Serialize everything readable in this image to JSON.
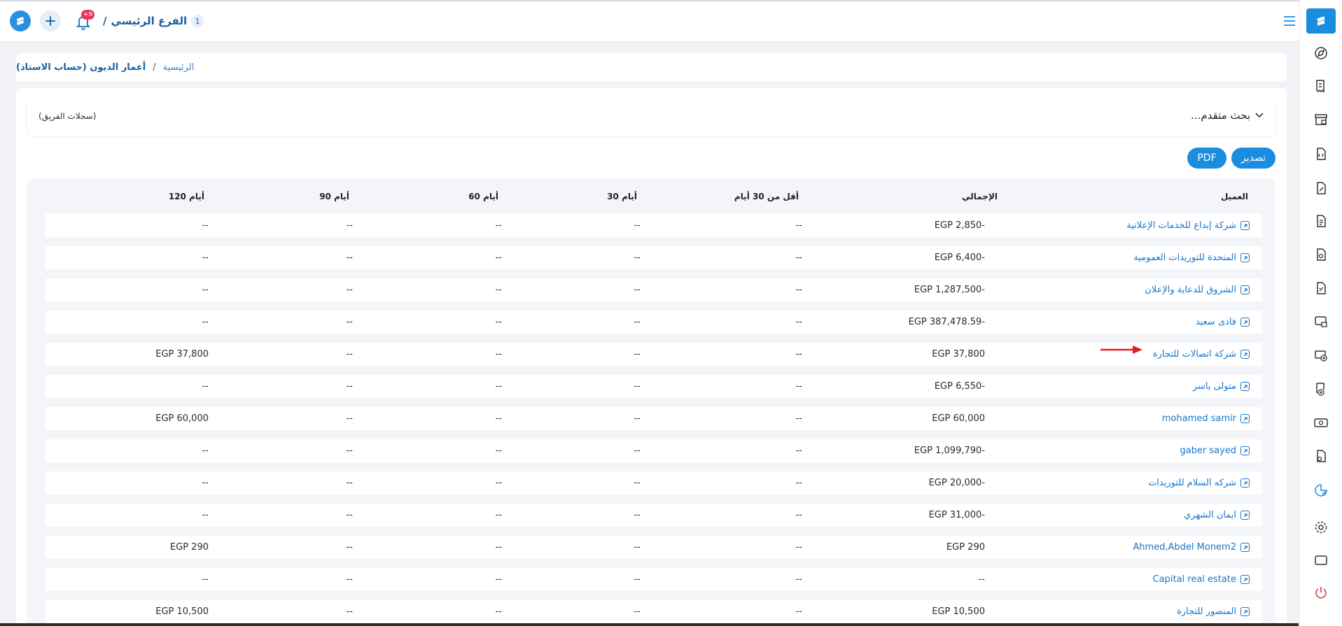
{
  "topbar": {
    "branch_count": "1",
    "branch_name": "الفرع الرئيسي",
    "branch_sep": "/",
    "notification_count": "+9"
  },
  "breadcrumb": {
    "home": "الرئيسية",
    "separator": "/",
    "current": "أعمار الديون (حساب الاستاذ)"
  },
  "search": {
    "label": "بحث متقدم...",
    "team_records": "(سجلات الفريق)"
  },
  "actions": {
    "export": "تصدير",
    "pdf": "PDF"
  },
  "table": {
    "headers": {
      "customer": "العميل",
      "total": "الإجمالي",
      "lt30": "أقل من 30 أيام",
      "d30": "30 أيام",
      "d60": "60 أيام",
      "d90": "90 أيام",
      "d120": "120 أيام"
    },
    "rows": [
      {
        "customer": "شركة إبداع للخدمات الإعلانية",
        "total": "EGP 2,850-",
        "lt30": "--",
        "d30": "--",
        "d60": "--",
        "d90": "--",
        "d120": "--"
      },
      {
        "customer": "المتحدة للتوريدات العمومية",
        "total": "EGP 6,400-",
        "lt30": "--",
        "d30": "--",
        "d60": "--",
        "d90": "--",
        "d120": "--"
      },
      {
        "customer": "الشروق للدعاية والإعلان",
        "total": "EGP 1,287,500-",
        "lt30": "--",
        "d30": "--",
        "d60": "--",
        "d90": "--",
        "d120": "--"
      },
      {
        "customer": "فادى سعيد",
        "total": "EGP 387,478.59-",
        "lt30": "--",
        "d30": "--",
        "d60": "--",
        "d90": "--",
        "d120": "--"
      },
      {
        "customer": "شركة اتصالات للتجارة",
        "total": "EGP 37,800",
        "lt30": "--",
        "d30": "--",
        "d60": "--",
        "d90": "--",
        "d120": "EGP 37,800"
      },
      {
        "customer": "متولى ياسر",
        "total": "EGP 6,550-",
        "lt30": "--",
        "d30": "--",
        "d60": "--",
        "d90": "--",
        "d120": "--"
      },
      {
        "customer": "mohamed samir",
        "total": "EGP 60,000",
        "lt30": "--",
        "d30": "--",
        "d60": "--",
        "d90": "--",
        "d120": "EGP 60,000"
      },
      {
        "customer": "gaber sayed",
        "total": "EGP 1,099,790-",
        "lt30": "--",
        "d30": "--",
        "d60": "--",
        "d90": "--",
        "d120": "--"
      },
      {
        "customer": "شركه السلام للتوريدات",
        "total": "EGP 20,000-",
        "lt30": "--",
        "d30": "--",
        "d60": "--",
        "d90": "--",
        "d120": "--"
      },
      {
        "customer": "ايمان الشهري",
        "total": "EGP 31,000-",
        "lt30": "--",
        "d30": "--",
        "d60": "--",
        "d90": "--",
        "d120": "--"
      },
      {
        "customer": "Ahmed,Abdel Monem2",
        "total": "EGP 290",
        "lt30": "--",
        "d30": "--",
        "d60": "--",
        "d90": "--",
        "d120": "EGP 290"
      },
      {
        "customer": "Capital real estate",
        "total": "--",
        "lt30": "--",
        "d30": "--",
        "d60": "--",
        "d90": "--",
        "d120": "--"
      },
      {
        "customer": "المنصور للتجارة",
        "total": "EGP 10,500",
        "lt30": "--",
        "d30": "--",
        "d60": "--",
        "d90": "--",
        "d120": "EGP 10,500"
      }
    ]
  },
  "colors": {
    "accent": "#1a8de0",
    "link": "#1a76c8",
    "annotation_arrow": "#e02020",
    "logout": "#e0344a"
  },
  "sidebar_icons": [
    "compass-icon",
    "receipt-icon",
    "store-icon",
    "document-code-icon",
    "document-edit-icon",
    "document-lines-icon",
    "document-tag-icon",
    "document-tag-alt-icon",
    "monitor-card-icon",
    "cash-add-icon",
    "receipt-add-icon",
    "banknote-icon",
    "document-user-icon",
    "report-chart-icon",
    "settings-icon",
    "screen-icon",
    "power-icon"
  ]
}
